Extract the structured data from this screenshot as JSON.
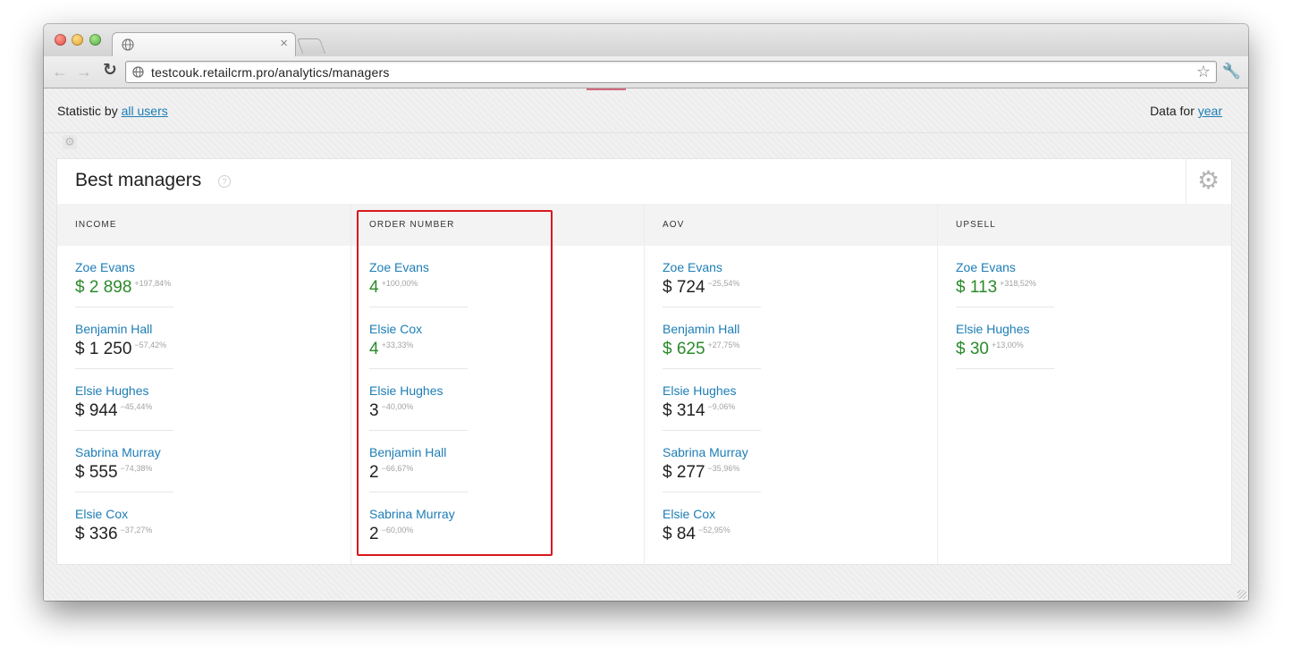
{
  "browser": {
    "url": "testcouk.retailcrm.pro/analytics/managers"
  },
  "filter": {
    "statistic_prefix": "Statistic by",
    "statistic_link": "all users",
    "data_prefix": "Data for",
    "data_link": "year"
  },
  "card": {
    "title": "Best managers",
    "help": "?"
  },
  "columns": [
    {
      "header": "INCOME",
      "entries": [
        {
          "name": "Zoe Evans",
          "value": "$ 2 898",
          "change": "+197,84%",
          "positive": true
        },
        {
          "name": "Benjamin Hall",
          "value": "$ 1 250",
          "change": "−57,42%",
          "positive": false
        },
        {
          "name": "Elsie Hughes",
          "value": "$ 944",
          "change": "−45,44%",
          "positive": false
        },
        {
          "name": "Sabrina Murray",
          "value": "$ 555",
          "change": "−74,38%",
          "positive": false
        },
        {
          "name": "Elsie Cox",
          "value": "$ 336",
          "change": "−37,27%",
          "positive": false
        }
      ]
    },
    {
      "header": "ORDER NUMBER",
      "entries": [
        {
          "name": "Zoe Evans",
          "value": "4",
          "change": "+100,00%",
          "positive": true
        },
        {
          "name": "Elsie Cox",
          "value": "4",
          "change": "+33,33%",
          "positive": true
        },
        {
          "name": "Elsie Hughes",
          "value": "3",
          "change": "−40,00%",
          "positive": false
        },
        {
          "name": "Benjamin Hall",
          "value": "2",
          "change": "−66,67%",
          "positive": false
        },
        {
          "name": "Sabrina Murray",
          "value": "2",
          "change": "−60,00%",
          "positive": false
        }
      ]
    },
    {
      "header": "AOV",
      "entries": [
        {
          "name": "Zoe Evans",
          "value": "$ 724",
          "change": "−25,54%",
          "positive": false
        },
        {
          "name": "Benjamin Hall",
          "value": "$ 625",
          "change": "+27,75%",
          "positive": true
        },
        {
          "name": "Elsie Hughes",
          "value": "$ 314",
          "change": "−9,06%",
          "positive": false
        },
        {
          "name": "Sabrina Murray",
          "value": "$ 277",
          "change": "−35,96%",
          "positive": false
        },
        {
          "name": "Elsie Cox",
          "value": "$ 84",
          "change": "−52,95%",
          "positive": false
        }
      ]
    },
    {
      "header": "UPSELL",
      "entries": [
        {
          "name": "Zoe Evans",
          "value": "$ 113",
          "change": "+318,52%",
          "positive": true
        },
        {
          "name": "Elsie Hughes",
          "value": "$ 30",
          "change": "+13,00%",
          "positive": true
        }
      ]
    }
  ],
  "icons": {
    "settings": "gear-icon",
    "help": "help-circle-icon",
    "favicon": "globe-icon"
  },
  "colors": {
    "link": "#1d7db6",
    "positive": "#2a8a2a",
    "highlight": "#d9181d"
  }
}
